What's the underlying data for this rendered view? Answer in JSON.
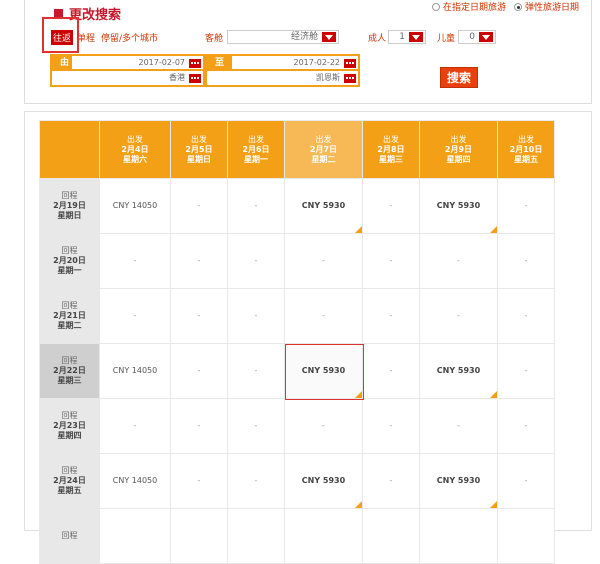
{
  "header": {
    "title": "更改搜索",
    "mode_options": [
      {
        "label": "在指定日期旅游",
        "selected": false
      },
      {
        "label": "弹性旅游日期",
        "selected": true
      }
    ]
  },
  "trip_tabs": [
    {
      "label": "往返",
      "active": true
    },
    {
      "label": "单程",
      "active": false
    },
    {
      "label": "停留/多个城市",
      "active": false
    }
  ],
  "cabin": {
    "label": "客舱",
    "value": "经济舱"
  },
  "adults": {
    "label": "成人",
    "value": "1"
  },
  "children": {
    "label": "儿童",
    "value": "0"
  },
  "route": {
    "from_label": "由",
    "to_label": "至",
    "depart_date": "2017-02-07",
    "return_date": "2017-02-22",
    "origin": "香港",
    "destination": "凯恩斯"
  },
  "search_button": "搜索",
  "grid": {
    "col_prefix": "出发",
    "row_prefix": "回程",
    "columns": [
      {
        "date": "2月4日",
        "weekday": "星期六"
      },
      {
        "date": "2月5日",
        "weekday": "星期日"
      },
      {
        "date": "2月6日",
        "weekday": "星期一"
      },
      {
        "date": "2月7日",
        "weekday": "星期二"
      },
      {
        "date": "2月8日",
        "weekday": "星期三"
      },
      {
        "date": "2月9日",
        "weekday": "星期四"
      },
      {
        "date": "2月10日",
        "weekday": "星期五"
      }
    ],
    "rows": [
      {
        "date": "2月19日",
        "weekday": "星期日",
        "cells": [
          "CNY 14050",
          "-",
          "-",
          "CNY 5930",
          "-",
          "CNY 5930",
          "-"
        ]
      },
      {
        "date": "2月20日",
        "weekday": "星期一",
        "cells": [
          "-",
          "-",
          "-",
          "-",
          "-",
          "-",
          "-"
        ]
      },
      {
        "date": "2月21日",
        "weekday": "星期二",
        "cells": [
          "-",
          "-",
          "-",
          "-",
          "-",
          "-",
          "-"
        ]
      },
      {
        "date": "2月22日",
        "weekday": "星期三",
        "cells": [
          "CNY 14050",
          "-",
          "-",
          "CNY 5930",
          "-",
          "CNY 5930",
          "-"
        ]
      },
      {
        "date": "2月23日",
        "weekday": "星期四",
        "cells": [
          "-",
          "-",
          "-",
          "-",
          "-",
          "-",
          "-"
        ]
      },
      {
        "date": "2月24日",
        "weekday": "星期五",
        "cells": [
          "CNY 14050",
          "-",
          "-",
          "CNY 5930",
          "-",
          "CNY 5930",
          "-"
        ]
      },
      {
        "date": "",
        "weekday": "",
        "cells": [
          "",
          "",
          "",
          "",
          "",
          "",
          ""
        ]
      }
    ],
    "selected_col": 3,
    "selected_row": 3,
    "colors": {
      "header": "#f3a016",
      "accent": "#c8192c",
      "button": "#e8410e"
    }
  }
}
